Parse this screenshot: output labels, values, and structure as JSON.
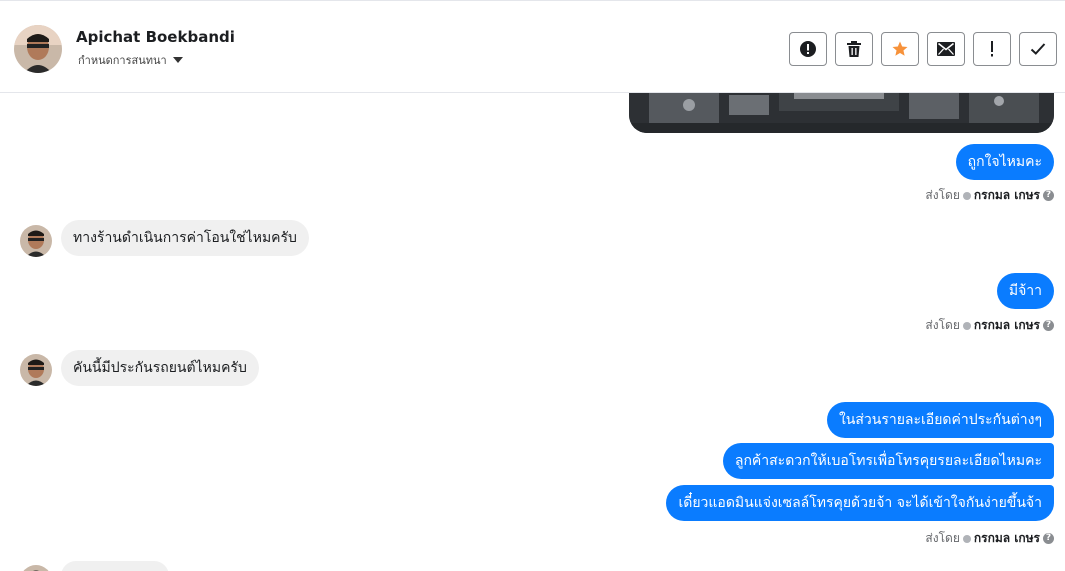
{
  "header": {
    "contact_name": "Apichat Boekbandi",
    "assign_label": "กำหนดการสนทนา",
    "toolbar": [
      {
        "name": "report-spam-button",
        "icon": "exclamation-circle-icon"
      },
      {
        "name": "delete-button",
        "icon": "trash-icon"
      },
      {
        "name": "star-button",
        "icon": "star-icon",
        "color": "#f7923a"
      },
      {
        "name": "mark-unread-button",
        "icon": "envelope-icon"
      },
      {
        "name": "follow-up-button",
        "icon": "exclamation-icon"
      },
      {
        "name": "mark-done-button",
        "icon": "check-icon"
      }
    ]
  },
  "messages": [
    {
      "id": "m1",
      "direction": "out",
      "text": "ถูกใจไหมคะ"
    },
    {
      "id": "s1",
      "sent_by_label": "ส่งโดย",
      "sender": "กรกมล เกษร"
    },
    {
      "id": "m2",
      "direction": "in",
      "text": "ทางร้านดำเนินการค่าโอนใช่ไหมครับ"
    },
    {
      "id": "m3",
      "direction": "out",
      "text": "มีจ้าา"
    },
    {
      "id": "s2",
      "sent_by_label": "ส่งโดย",
      "sender": "กรกมล เกษร"
    },
    {
      "id": "m4",
      "direction": "in",
      "text": "คันนี้มีประกันรถยนต์ไหมครับ"
    },
    {
      "id": "m5",
      "direction": "out",
      "text": "ในส่วนรายละเอียดค่าประกันต่างๆ"
    },
    {
      "id": "m6",
      "direction": "out",
      "text": "ลูกค้าสะดวกให้เบอโทรเพื่อโทรคุยรยละเอียดไหมคะ"
    },
    {
      "id": "m7",
      "direction": "out",
      "text": "เดี๋ยวแอดมินแจ่งเซลล์โทรคุยด้วยจ้า จะได้เข้าใจกันง่ายขึ้นจ้า"
    },
    {
      "id": "s3",
      "sent_by_label": "ส่งโดย",
      "sender": "กรกมล เกษร"
    }
  ],
  "colors": {
    "outgoing_bubble": "#0a7cff",
    "incoming_bubble": "#f0f0f0",
    "star": "#f7923a"
  }
}
